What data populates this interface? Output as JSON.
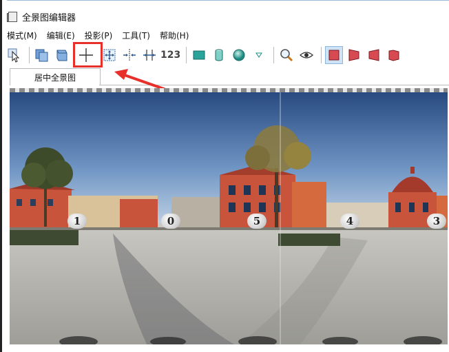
{
  "window": {
    "title": "全景图编辑器"
  },
  "menu": [
    "模式(M)",
    "编辑(E)",
    "投影(P)",
    "工具(T)",
    "帮助(H)"
  ],
  "toolbar": {
    "buttons": [
      {
        "name": "select-tool-button",
        "icon": "cursor-icon"
      },
      {
        "name": "copy-image-button",
        "icon": "copy-icon"
      },
      {
        "name": "paste-image-button",
        "icon": "paste-icon"
      },
      {
        "name": "center-crosshair-button",
        "icon": "crosshair-icon",
        "highlighted": true
      },
      {
        "name": "fit-view-button",
        "icon": "fit-arrows-icon"
      },
      {
        "name": "horizontal-center-button",
        "icon": "horizontal-center-icon"
      },
      {
        "name": "vertical-center-button",
        "icon": "vertical-center-icon"
      },
      {
        "name": "show-numbers-button",
        "label": "123"
      },
      {
        "name": "plane-projection-button",
        "icon": "plane-icon"
      },
      {
        "name": "cylinder-projection-button",
        "icon": "cylinder-icon"
      },
      {
        "name": "sphere-projection-button",
        "icon": "sphere-icon"
      },
      {
        "name": "projection-dropdown-button",
        "icon": "triangle-down-icon"
      },
      {
        "name": "zoom-button",
        "icon": "magnifier-icon"
      },
      {
        "name": "preview-button",
        "icon": "eye-icon"
      },
      {
        "name": "view-front-button",
        "icon": "panel-front-icon",
        "pressed": true
      },
      {
        "name": "view-left-button",
        "icon": "panel-left-icon"
      },
      {
        "name": "view-right-button",
        "icon": "panel-right-icon"
      },
      {
        "name": "view-back-button",
        "icon": "panel-back-icon"
      }
    ],
    "numbers_label": "123"
  },
  "tabs": [
    {
      "label": "居中全景图",
      "active": true
    }
  ],
  "panorama": {
    "markers": [
      "1",
      "0",
      "5",
      "4",
      "3"
    ]
  },
  "colors": {
    "highlight": "#e8302a",
    "sky_top": "#2c4f86",
    "sky_bottom": "#a9c1de",
    "ground": "#b9b8b3",
    "building": "#c8553b"
  }
}
